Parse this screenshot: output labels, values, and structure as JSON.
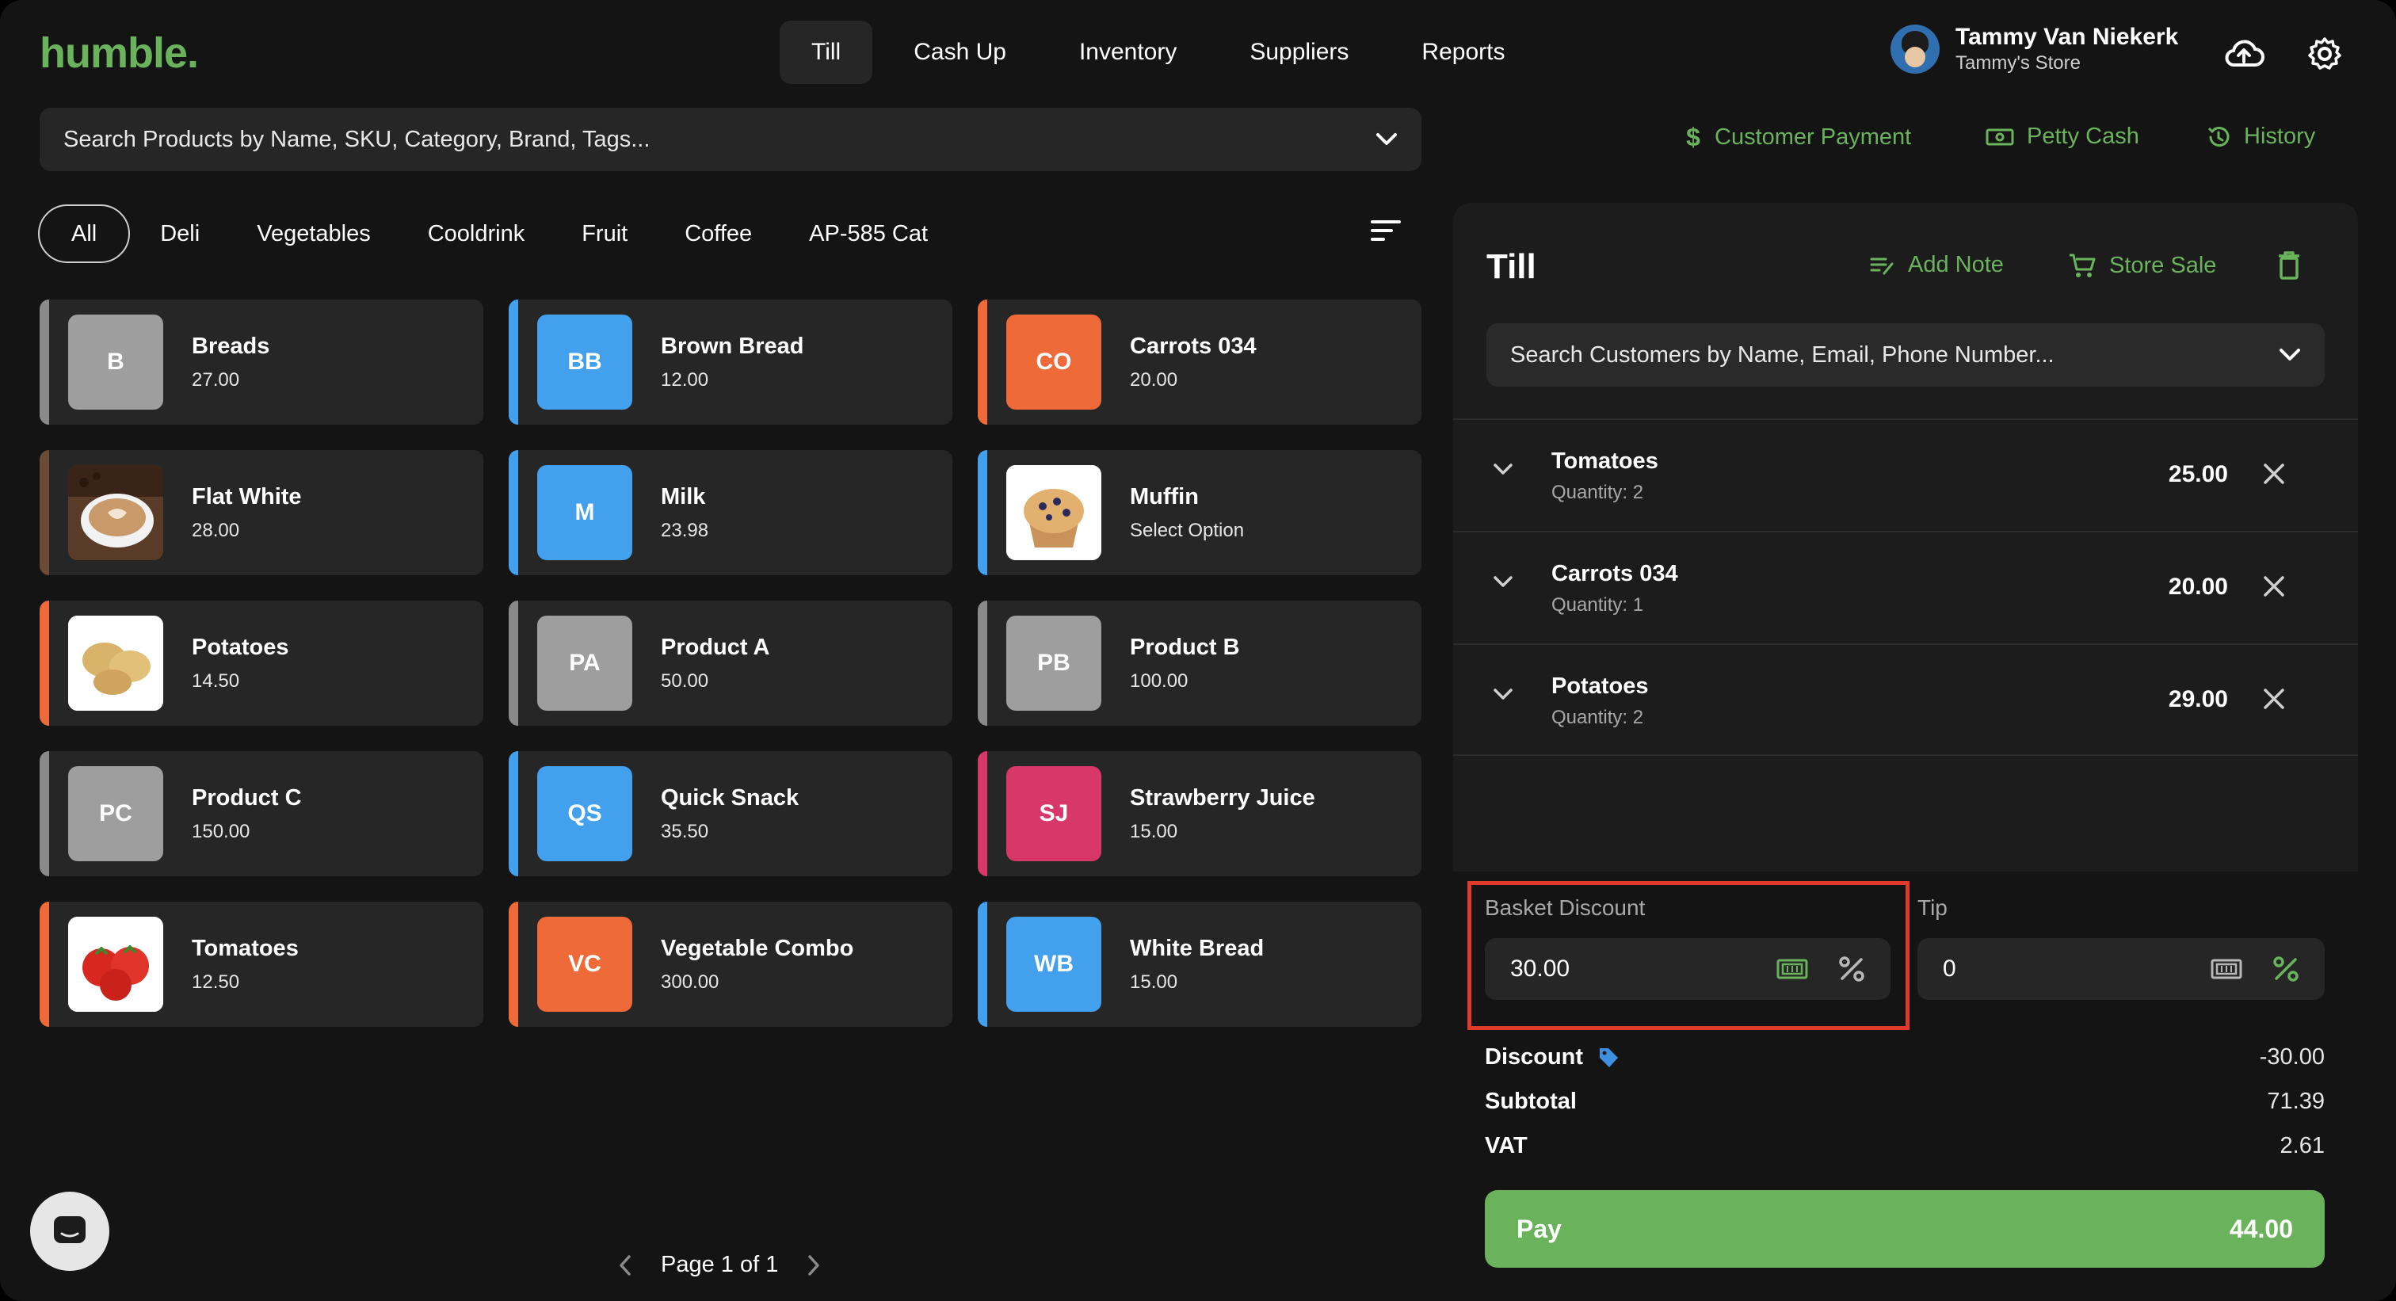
{
  "app": {
    "logo": "humble."
  },
  "nav": {
    "items": [
      "Till",
      "Cash Up",
      "Inventory",
      "Suppliers",
      "Reports"
    ],
    "active": "Till"
  },
  "user": {
    "name": "Tammy Van Niekerk",
    "store": "Tammy's Store"
  },
  "header_icons": [
    "cloud-upload-icon",
    "gear-icon"
  ],
  "search": {
    "placeholder": "Search Products by Name, SKU, Category, Brand, Tags..."
  },
  "actions": {
    "customer_payment": "Customer Payment",
    "petty_cash": "Petty Cash",
    "history": "History"
  },
  "categories": [
    "All",
    "Deli",
    "Vegetables",
    "Cooldrink",
    "Fruit",
    "Coffee",
    "AP-585 Cat"
  ],
  "products": [
    {
      "name": "Breads",
      "price": "27.00",
      "initials": "B",
      "color": "#9e9e9e",
      "stripe": "#8a8a8a",
      "image": null
    },
    {
      "name": "Brown Bread",
      "price": "12.00",
      "initials": "BB",
      "color": "#42a0ec",
      "stripe": "#42a0ec",
      "image": null
    },
    {
      "name": "Carrots 034",
      "price": "20.00",
      "initials": "CO",
      "color": "#ee6a38",
      "stripe": "#ee6a38",
      "image": null
    },
    {
      "name": "Flat White",
      "price": "28.00",
      "initials": "",
      "color": "#6b4a36",
      "stripe": "#6b4a36",
      "image": "coffee"
    },
    {
      "name": "Milk",
      "price": "23.98",
      "initials": "M",
      "color": "#42a0ec",
      "stripe": "#42a0ec",
      "image": null
    },
    {
      "name": "Muffin",
      "price": "Select Option",
      "initials": "",
      "color": "#ffffff",
      "stripe": "#42a0ec",
      "image": "muffin"
    },
    {
      "name": "Potatoes",
      "price": "14.50",
      "initials": "",
      "color": "#ffffff",
      "stripe": "#ee6a38",
      "image": "potatoes"
    },
    {
      "name": "Product A",
      "price": "50.00",
      "initials": "PA",
      "color": "#9e9e9e",
      "stripe": "#8a8a8a",
      "image": null
    },
    {
      "name": "Product B",
      "price": "100.00",
      "initials": "PB",
      "color": "#9e9e9e",
      "stripe": "#8a8a8a",
      "image": null
    },
    {
      "name": "Product C",
      "price": "150.00",
      "initials": "PC",
      "color": "#9e9e9e",
      "stripe": "#8a8a8a",
      "image": null
    },
    {
      "name": "Quick Snack",
      "price": "35.50",
      "initials": "QS",
      "color": "#42a0ec",
      "stripe": "#42a0ec",
      "image": null
    },
    {
      "name": "Strawberry Juice",
      "price": "15.00",
      "initials": "SJ",
      "color": "#d8376a",
      "stripe": "#d8376a",
      "image": null
    },
    {
      "name": "Tomatoes",
      "price": "12.50",
      "initials": "",
      "color": "#ffffff",
      "stripe": "#ee6a38",
      "image": "tomatoes"
    },
    {
      "name": "Vegetable Combo",
      "price": "300.00",
      "initials": "VC",
      "color": "#ee6a38",
      "stripe": "#ee6a38",
      "image": null
    },
    {
      "name": "White Bread",
      "price": "15.00",
      "initials": "WB",
      "color": "#42a0ec",
      "stripe": "#42a0ec",
      "image": null
    }
  ],
  "pagination": {
    "text": "Page 1 of 1"
  },
  "till": {
    "title": "Till",
    "add_note": "Add Note",
    "store_sale": "Store Sale",
    "customer_search": {
      "placeholder": "Search Customers by Name, Email, Phone Number..."
    },
    "lines": [
      {
        "name": "Tomatoes",
        "quantity": "Quantity: 2",
        "price": "25.00"
      },
      {
        "name": "Carrots 034",
        "quantity": "Quantity: 1",
        "price": "20.00"
      },
      {
        "name": "Potatoes",
        "quantity": "Quantity: 2",
        "price": "29.00"
      }
    ],
    "basket_discount": {
      "label": "Basket Discount",
      "value": "30.00"
    },
    "tip": {
      "label": "Tip",
      "value": "0"
    },
    "summary": {
      "discount_label": "Discount",
      "discount_value": "-30.00",
      "subtotal_label": "Subtotal",
      "subtotal_value": "71.39",
      "vat_label": "VAT",
      "vat_value": "2.61"
    },
    "pay": {
      "label": "Pay",
      "amount": "44.00"
    }
  },
  "colors": {
    "accent": "#6ab35c",
    "highlight": "#e03a2a",
    "background": "#141414",
    "card": "#262626"
  }
}
